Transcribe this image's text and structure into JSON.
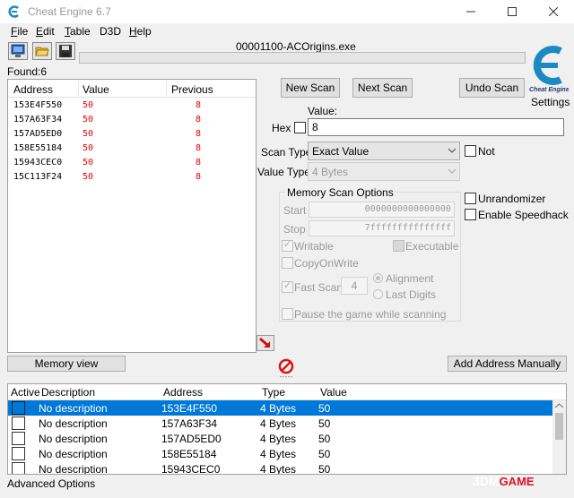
{
  "window": {
    "title": "Cheat Engine 6.7"
  },
  "menu": [
    {
      "pre": "",
      "u": "F",
      "post": "ile"
    },
    {
      "pre": "",
      "u": "E",
      "post": "dit"
    },
    {
      "pre": "",
      "u": "T",
      "post": "able"
    },
    {
      "pre": "D3D",
      "u": "",
      "post": ""
    },
    {
      "pre": "",
      "u": "H",
      "post": "elp"
    }
  ],
  "process_title": "00001100-ACOrigins.exe",
  "progress": 0,
  "found_label": "Found:",
  "found_count": "6",
  "settings_label": "Settings",
  "results": {
    "headers": [
      "Address",
      "Value",
      "Previous"
    ],
    "rows": [
      [
        "153E4F550",
        "50",
        "8"
      ],
      [
        "157A63F34",
        "50",
        "8"
      ],
      [
        "157AD5ED0",
        "50",
        "8"
      ],
      [
        "158E55184",
        "50",
        "8"
      ],
      [
        "15943CEC0",
        "50",
        "8"
      ],
      [
        "15C113F24",
        "50",
        "8"
      ]
    ]
  },
  "buttons": {
    "new_scan": "New Scan",
    "next_scan": "Next Scan",
    "undo_scan": "Undo Scan",
    "memory_view": "Memory view",
    "add_address": "Add Address Manually"
  },
  "value": {
    "label": "Value:",
    "hex_label": "Hex",
    "input": "8"
  },
  "scan_type": {
    "label": "Scan Type",
    "selected": "Exact Value",
    "not_label": "Not"
  },
  "value_type": {
    "label": "Value Type",
    "selected": "4 Bytes"
  },
  "memory_options": {
    "title": "Memory Scan Options",
    "start_label": "Start",
    "start_value": "0000000000000000",
    "stop_label": "Stop",
    "stop_value": "7fffffffffffffff",
    "writable": "Writable",
    "executable": "Executable",
    "copyonwrite": "CopyOnWrite",
    "fast_scan": "Fast Scan",
    "fast_scan_value": "4",
    "alignment": "Alignment",
    "last_digits": "Last Digits",
    "pause": "Pause the game while scanning"
  },
  "unrandomizer": "Unrandomizer",
  "speedhack": "Enable Speedhack",
  "address_table": {
    "headers": [
      "Active",
      "Description",
      "Address",
      "Type",
      "Value"
    ],
    "rows": [
      [
        "No description",
        "153E4F550",
        "4 Bytes",
        "50"
      ],
      [
        "No description",
        "157A63F34",
        "4 Bytes",
        "50"
      ],
      [
        "No description",
        "157AD5ED0",
        "4 Bytes",
        "50"
      ],
      [
        "No description",
        "158E55184",
        "4 Bytes",
        "50"
      ],
      [
        "No description",
        "15943CEC0",
        "4 Bytes",
        "50"
      ]
    ]
  },
  "advanced_options": "Advanced Options",
  "watermark": {
    "main": "3DM",
    "sub": "GAME"
  },
  "colors": {
    "selection": "#0078d7",
    "red_value": "#ee0000",
    "logo": "#1b8ac2"
  }
}
